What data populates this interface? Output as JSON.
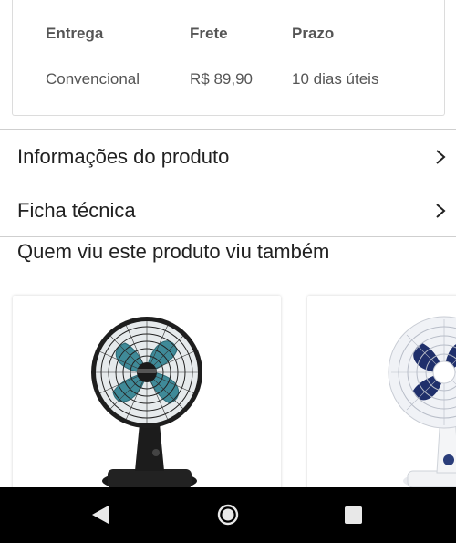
{
  "shipping": {
    "headers": [
      "Entrega",
      "Frete",
      "Prazo"
    ],
    "row": [
      "Convencional",
      "R$ 89,90",
      "10 dias úteis"
    ]
  },
  "sections": [
    {
      "label": "Informações do produto",
      "icon": "chevron-right-icon"
    },
    {
      "label": "Ficha técnica",
      "icon": "chevron-right-icon"
    }
  ],
  "related": {
    "title": "Quem viu este produto viu também",
    "products": [
      {
        "image": "black-teal-table-fan"
      },
      {
        "image": "white-navy-table-fan"
      }
    ]
  },
  "navbar": {
    "icons": [
      "back-triangle-icon",
      "home-circle-icon",
      "recents-square-icon"
    ]
  }
}
